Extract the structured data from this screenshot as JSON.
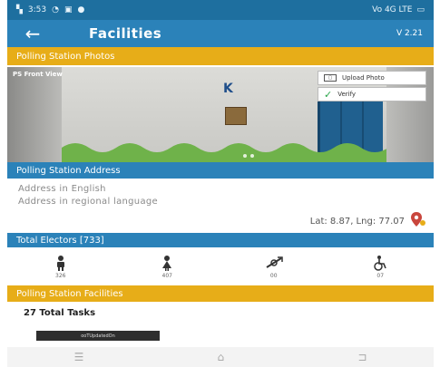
{
  "status_bar": {
    "time": "3:53",
    "left_icons": [
      "sim-icon",
      "wifi-icon",
      "notification-icon",
      "media-icon"
    ],
    "right_text": "Vo 4G LTE"
  },
  "app_bar": {
    "title": "Facilities",
    "version": "V 2.21"
  },
  "photos_section": {
    "header": "Polling Station Photos",
    "front_view_label": "PS Front View",
    "upload_label": "Upload Photo",
    "verify_label": "Verify"
  },
  "address_section": {
    "header": "Polling Station Address",
    "address_english": "Address in English",
    "address_regional": "Address in regional language",
    "lat_lng": "Lat: 8.87, Lng: 77.07"
  },
  "electors_section": {
    "header": "Total Electors [733]",
    "items": [
      {
        "icon": "male-elector-icon",
        "count": "326"
      },
      {
        "icon": "female-elector-icon",
        "count": "407"
      },
      {
        "icon": "third-gender-icon",
        "count": "00"
      },
      {
        "icon": "disabled-elector-icon",
        "count": "07"
      }
    ]
  },
  "facilities_section": {
    "header": "Polling Station Facilities",
    "total_tasks": "27 Total Tasks",
    "chip_label": "ooTUpdatedOn"
  },
  "nav_bar": {
    "items": [
      "recent-apps-icon",
      "home-icon",
      "back-icon"
    ]
  },
  "colors": {
    "primary_blue": "#2b82b9",
    "accent_yellow": "#e7ad18",
    "verify_green": "#2aa64a",
    "pin_red": "#c9463d"
  }
}
